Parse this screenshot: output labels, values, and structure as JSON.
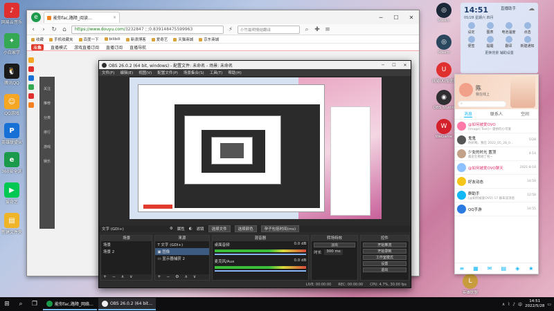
{
  "desktop": {
    "left_icons": [
      {
        "label": "网易云音乐",
        "color": "#e02f2f",
        "glyph": "♪"
      },
      {
        "label": "小白家学",
        "color": "#34a853",
        "glyph": "✦"
      },
      {
        "label": "腾讯QQ",
        "color": "#1a1a1a",
        "glyph": "🐧"
      },
      {
        "label": "QQ游戏",
        "color": "#f5a623",
        "glyph": "☺"
      },
      {
        "label": "英雄联盟WeGame",
        "color": "#1670d5",
        "glyph": "P"
      },
      {
        "label": "360安全浏览器",
        "color": "#1a9a4a",
        "glyph": "e"
      },
      {
        "label": "爱奇艺",
        "color": "#00c853",
        "glyph": "▶"
      },
      {
        "label": "新建文件夹",
        "color": "#f0b429",
        "glyph": "▤"
      }
    ],
    "right_icons": [
      {
        "label": "Steam",
        "color": "#1b2838",
        "glyph": "◎"
      },
      {
        "label": "Steam",
        "color": "#2a475e",
        "glyph": "◎"
      },
      {
        "label": "网易UU加速器",
        "color": "#e02f2f",
        "glyph": "U"
      },
      {
        "label": "OBS Studio",
        "color": "#302e31",
        "glyph": "◉"
      },
      {
        "label": "WeGame",
        "color": "#d4202a",
        "glyph": "W"
      },
      {
        "label": "英雄联盟",
        "color": "#c89b3c",
        "glyph": "L"
      }
    ]
  },
  "browser": {
    "tab_title": "能你fac,路障_阅读…",
    "address_secure": "https://www.douyu.com/",
    "address_rest": "3232847 ⬚0.839148475599963",
    "search_placeholder": "小竹最明情结翻译",
    "bookmarks": [
      "收藏",
      "手机收藏夹",
      "百度一下",
      "bilibili",
      "新浪博客",
      "爱奇艺",
      "天猫商城",
      "京东商城"
    ],
    "site_logo": "斗鱼",
    "site_nav": [
      "直播模式",
      "游戏直播订阅",
      "直播订阅",
      "直播导航"
    ],
    "side_labels": [
      "关注",
      "推荐",
      "分类",
      "排行",
      "游戏",
      "娱乐"
    ]
  },
  "obs": {
    "title": "OBS 26.0.2 (64 bit, windows) - 配置文件: 未命名 - 场景: 未命名",
    "menu": [
      "文件(F)",
      "编辑(E)",
      "视图(V)",
      "配置文件(P)",
      "场景集合(S)",
      "工具(T)",
      "帮助(H)"
    ],
    "status_row": {
      "source_label": "文字 (GDI+)",
      "properties": "属性",
      "filters": "滤镜",
      "btn1": "选择文件",
      "btn2": "选择颜色",
      "btn3": "孕子包括时间(ms)"
    },
    "docks": {
      "scenes_header": "场景",
      "scenes": [
        "场景",
        "场景 2"
      ],
      "sources_header": "来源",
      "sources": [
        "文字 (GDI+)",
        "图像",
        "显示器捕获 2"
      ],
      "mixer_header": "混音器",
      "mixer": [
        {
          "name": "桌面音频",
          "db": "0.0 dB"
        },
        {
          "name": "麦克风/Aux",
          "db": "0.0 dB"
        }
      ],
      "transitions_header": "转场特效",
      "transition_type": "淡出",
      "duration_label": "时长",
      "duration_value": "300 ms",
      "controls_header": "控件",
      "controls": [
        "开始推流",
        "开始录制",
        "工作室模式",
        "设置",
        "退出"
      ]
    },
    "statusbar": {
      "live": "LIVE: 00:00:00",
      "rec": "REC: 00:00:00",
      "cpu": "CPU: 4.7%, 30.00 fps"
    }
  },
  "weather": {
    "time": "14:51",
    "date": "05/28 星期六 四月",
    "title": "直播助手",
    "grid": [
      "设定",
      "图表",
      "电池温度",
      "点选",
      "便签",
      "提醒",
      "翻译",
      "新建通知"
    ],
    "footer": "更换背景  辅助设置"
  },
  "qq": {
    "username": "陈",
    "status": "我在线上",
    "tabs": [
      "消息",
      "联系人",
      "空间"
    ],
    "chats": [
      {
        "name": "@如何被爱OVO",
        "preview": "[Image] Text]~ 傲娇的小可爱",
        "time": "",
        "color": "#ff7aa8"
      },
      {
        "name": "鬼鬼",
        "preview": "你好啊，我在 2022_05_28_0…",
        "time": "5/28",
        "color": "#555"
      },
      {
        "name": "少女的时光 置顶",
        "preview": "最近在看她了啦~",
        "time": "4-14",
        "color": "#c3a28a"
      },
      {
        "name": "@如何被爱OVO聊天",
        "preview": "",
        "time": "2021-8-18",
        "color": "#8ec1ff"
      },
      {
        "name": "好友动态",
        "preview": "",
        "time": "14:50",
        "color": "#f5c518"
      },
      {
        "name": "群助手",
        "preview": "[@如何被爱OVO] 17 群未读消息",
        "time": "12:58",
        "color": "#12b7f5"
      },
      {
        "name": "QQ手游",
        "preview": "",
        "time": "14:55",
        "color": "#2a7ae2"
      }
    ]
  },
  "taskbar": {
    "tasks": [
      {
        "label": "能你fac,路障_网络…",
        "active": false
      },
      {
        "label": "OBS 26.0.2 (64 bit…",
        "active": true
      }
    ],
    "time": "14:51",
    "date": "2022/5/28",
    "lang": "中"
  }
}
